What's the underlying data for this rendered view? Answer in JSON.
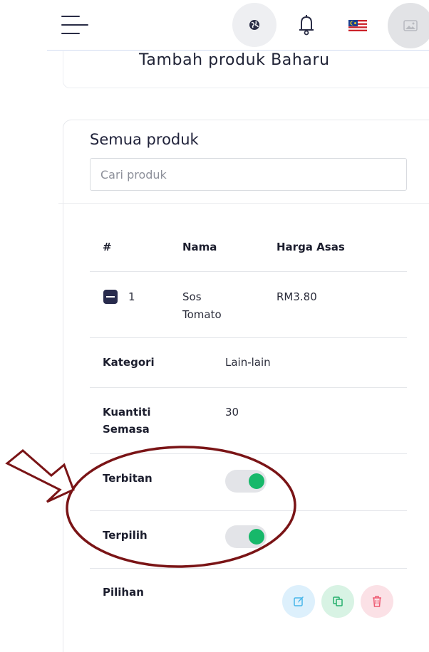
{
  "header": {
    "menu_icon": "hamburger-menu-icon",
    "globe_icon": "globe-icon",
    "bell_icon": "bell-icon",
    "flag_icon": "malaysia-flag-icon",
    "avatar_icon": "image-placeholder-icon"
  },
  "add_product": {
    "title": "Tambah produk Baharu"
  },
  "products": {
    "title": "Semua produk",
    "search_placeholder": "Cari produk",
    "columns": [
      "#",
      "Nama",
      "Harga Asas"
    ],
    "row": {
      "index": "1",
      "name_line1": "Sos",
      "name_line2": "Tomato",
      "price": "RM3.80"
    },
    "details": {
      "category_label": "Kategori",
      "category_value": "Lain-lain",
      "qty_label_line1": "Kuantiti",
      "qty_label_line2": "Semasa",
      "qty_value": "30",
      "published_label": "Terbitan",
      "published": true,
      "featured_label": "Terpilih",
      "featured": true,
      "options_label": "Pilihan"
    },
    "actions": [
      "edit-icon",
      "copy-icon",
      "trash-icon"
    ]
  },
  "colors": {
    "toggle_on": "#17b86a",
    "annotation": "#7a1416",
    "primary_dark": "#282b4d"
  }
}
